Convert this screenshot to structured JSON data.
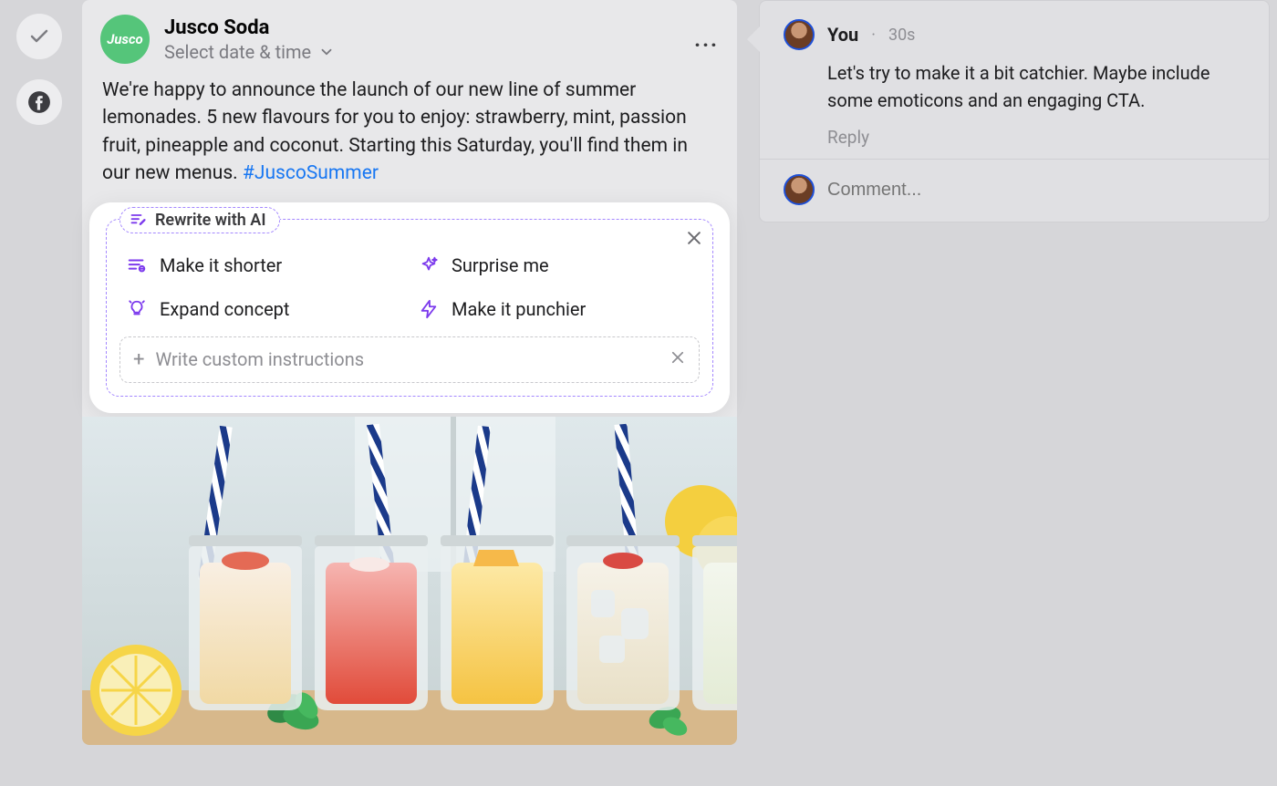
{
  "left": {
    "confirm": "check",
    "network": "facebook"
  },
  "post": {
    "brand": "Jusco",
    "title": "Jusco Soda",
    "date_label": "Select date & time",
    "body_text": "We're happy to announce the launch of our new line of summer lemonades. 5 new flavours for you to enjoy: strawberry, mint, passion fruit, pineapple and coconut. Starting this Saturday, you'll find them in our new menus. ",
    "hashtag": "#JuscoSummer"
  },
  "ai": {
    "legend": "Rewrite with AI",
    "options": [
      {
        "icon": "shorter",
        "label": "Make it shorter"
      },
      {
        "icon": "sparkle",
        "label": "Surprise me"
      },
      {
        "icon": "bulb",
        "label": "Expand concept"
      },
      {
        "icon": "bolt",
        "label": "Make it punchier"
      }
    ],
    "custom_placeholder": "Write custom instructions"
  },
  "comments": {
    "author": "You",
    "time_sep": "·",
    "time": "30s",
    "text": "Let's try to make it a bit catchier. Maybe include some emoticons and an engaging CTA.",
    "reply": "Reply",
    "input_placeholder": "Comment..."
  }
}
